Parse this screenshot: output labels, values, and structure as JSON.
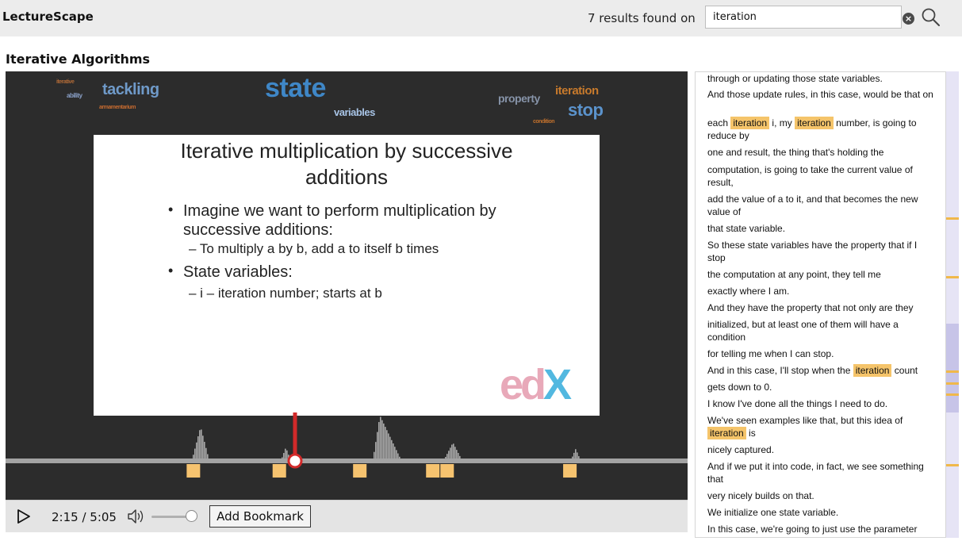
{
  "app": {
    "name": "LectureScape"
  },
  "search": {
    "results_text": "7 results found on",
    "value": "iteration",
    "clear_label": "×"
  },
  "page": {
    "title": "Iterative Algorithms"
  },
  "word_cloud": [
    {
      "text": "iterative",
      "color": "#b06a37",
      "size": 7
    },
    {
      "text": "ability",
      "color": "#8aa0c8",
      "size": 8
    },
    {
      "text": "tackling",
      "color": "#6f9ac9",
      "size": 20
    },
    {
      "text": "armamentarium",
      "color": "#c46a30",
      "size": 7
    },
    {
      "text": "state",
      "color": "#3f87c7",
      "size": 34
    },
    {
      "text": "variables",
      "color": "#a8c4e6",
      "size": 13
    },
    {
      "text": "property",
      "color": "#8693a8",
      "size": 14
    },
    {
      "text": "iteration",
      "color": "#c77a2c",
      "size": 15
    },
    {
      "text": "stop",
      "color": "#5b93cc",
      "size": 22
    },
    {
      "text": "condition",
      "color": "#c0702c",
      "size": 7
    }
  ],
  "slide": {
    "title_line1": "Iterative multiplication by successive",
    "title_line2": "additions",
    "bullet1": "Imagine we want to perform multiplication by successive additions:",
    "sub1": "– To multiply a by b, add a to itself b times",
    "bullet2": "State variables:",
    "sub2": "– i – iteration number; starts at b",
    "logo_a": "ed",
    "logo_b": "X"
  },
  "timeline": {
    "progress": 0.4244,
    "result_markers": [
      0.276,
      0.402,
      0.52,
      0.627,
      0.648,
      0.828
    ]
  },
  "controls": {
    "time": "2:15 / 5:05",
    "bookmark_label": "Add Bookmark",
    "volume": 0.85
  },
  "transcript": [
    {
      "parts": [
        {
          "t": "through or updating those state variables."
        }
      ]
    },
    {
      "parts": [
        {
          "t": "And those update rules, in this case, would be that on"
        }
      ]
    },
    {
      "parts": [
        {
          "t": "each "
        },
        {
          "t": "iteration",
          "hl": true
        },
        {
          "t": " i, my "
        },
        {
          "t": "iteration",
          "hl": true
        },
        {
          "t": " number, is going to reduce by"
        }
      ]
    },
    {
      "parts": [
        {
          "t": "one and result, the thing that's holding the"
        }
      ]
    },
    {
      "parts": [
        {
          "t": "computation, is going to take the current value of result,"
        }
      ]
    },
    {
      "parts": [
        {
          "t": "add the value of a to it, and that becomes the new value of"
        }
      ]
    },
    {
      "parts": [
        {
          "t": "that state variable."
        }
      ]
    },
    {
      "parts": [
        {
          "t": "So these state variables have the property that if I stop"
        }
      ]
    },
    {
      "parts": [
        {
          "t": "the computation at any point, they tell me"
        }
      ]
    },
    {
      "parts": [
        {
          "t": "exactly where I am."
        }
      ]
    },
    {
      "parts": [
        {
          "t": "And they have the property that not only are they"
        }
      ]
    },
    {
      "parts": [
        {
          "t": "initialized, but at least one of them will have a condition"
        }
      ]
    },
    {
      "parts": [
        {
          "t": "for telling me when I can stop."
        }
      ]
    },
    {
      "parts": [
        {
          "t": "And in this case, I'll stop when the "
        },
        {
          "t": "iteration",
          "hl": true
        },
        {
          "t": " count"
        }
      ]
    },
    {
      "parts": [
        {
          "t": "gets down to 0."
        }
      ]
    },
    {
      "parts": [
        {
          "t": "I know I've done all the things I need to do."
        }
      ]
    },
    {
      "parts": [
        {
          "t": "We've seen examples like that, but this idea of "
        },
        {
          "t": "iteration",
          "hl": true
        },
        {
          "t": " is"
        }
      ]
    },
    {
      "parts": [
        {
          "t": "nicely captured."
        }
      ]
    },
    {
      "parts": [
        {
          "t": "And if we put it into code, in fact, we see something that"
        }
      ]
    },
    {
      "parts": [
        {
          "t": "very nicely builds on that."
        }
      ]
    },
    {
      "parts": [
        {
          "t": "We initialize one state variable."
        }
      ]
    },
    {
      "parts": [
        {
          "t": "In this case, we're going to just use the parameter"
        }
      ]
    }
  ],
  "scrollbar": {
    "markers": [
      0.313,
      0.438,
      0.642,
      0.666,
      0.69,
      0.842
    ]
  }
}
